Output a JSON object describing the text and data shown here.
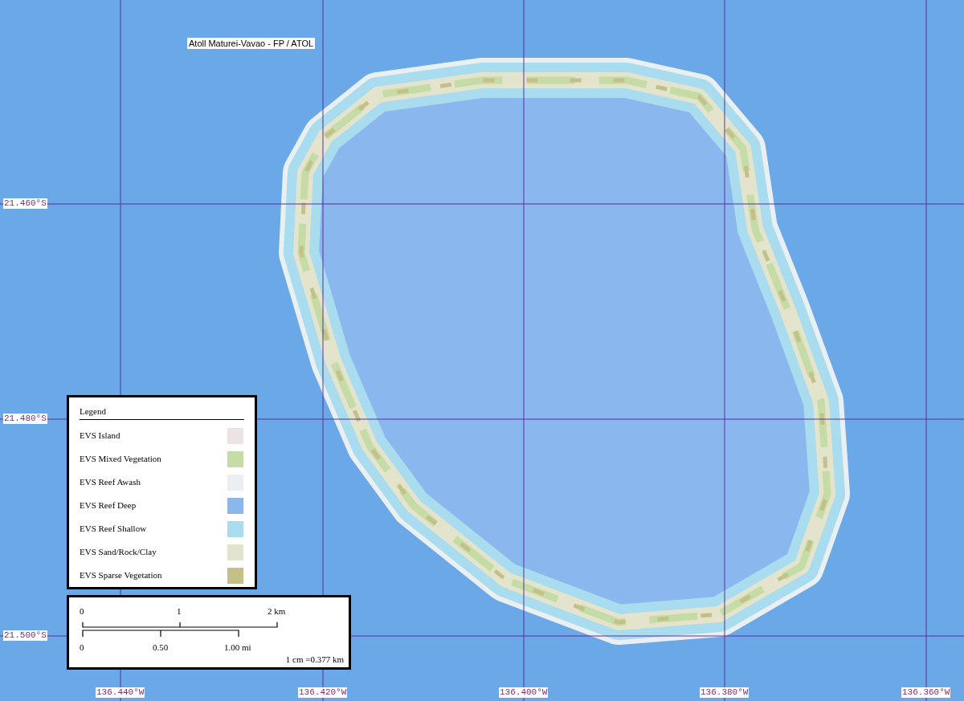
{
  "map_title": "Atoll Maturei-Vavao - FP / ATOL",
  "latitude_labels": [
    "21.460°S",
    "21.480°S",
    "21.500°S"
  ],
  "longitude_labels": [
    "136.440°W",
    "136.420°W",
    "136.400°W",
    "136.380°W",
    "136.360°W"
  ],
  "legend": {
    "title": "Legend",
    "items": [
      {
        "label": "EVS Island",
        "color": "#ece4e0"
      },
      {
        "label": "EVS Mixed Vegetation",
        "color": "#c5dca6"
      },
      {
        "label": "EVS Reef Awash",
        "color": "#eaf0f2"
      },
      {
        "label": "EVS Reef Deep",
        "color": "#8ab8ee"
      },
      {
        "label": "EVS Reef Shallow",
        "color": "#a8dcee"
      },
      {
        "label": "EVS Sand/Rock/Clay",
        "color": "#e4e4cc"
      },
      {
        "label": "EVS Sparse Vegetation",
        "color": "#c4c088"
      }
    ]
  },
  "scale_bar": {
    "km_labels": [
      "0",
      "1",
      "2 km"
    ],
    "mi_labels": [
      "0",
      "0.50",
      "1.00 mi"
    ],
    "ratio": "1 cm =0.377 km"
  }
}
